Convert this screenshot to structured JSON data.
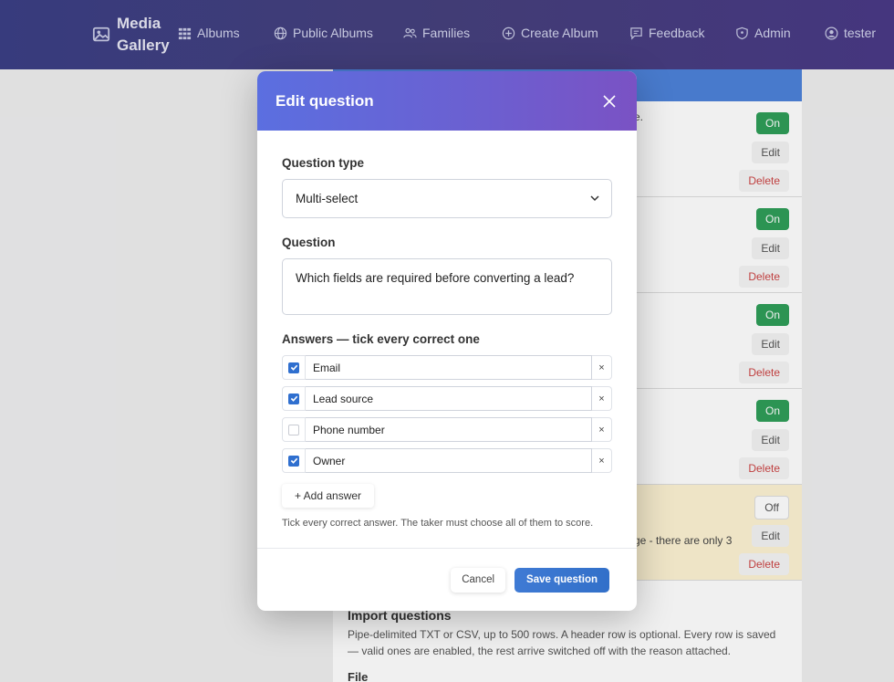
{
  "navbar": {
    "brand_line1": "Media",
    "brand_line2": "Gallery",
    "links": [
      {
        "label": "Albums",
        "icon": "grid-icon"
      },
      {
        "label": "Public Albums",
        "icon": "globe-icon"
      },
      {
        "label": "Families",
        "icon": "people-icon"
      },
      {
        "label": "Create Album",
        "icon": "plus-circle-icon"
      },
      {
        "label": "Feedback",
        "icon": "chat-icon"
      },
      {
        "label": "Admin",
        "icon": "shield-icon"
      },
      {
        "label": "tester",
        "icon": "user-circle-icon"
      }
    ]
  },
  "background": {
    "rows": [
      {
        "toggle": "On",
        "edit": "Edit",
        "delete": "Delete",
        "note": "e."
      },
      {
        "toggle": "On",
        "edit": "Edit",
        "delete": "Delete"
      },
      {
        "toggle": "On",
        "edit": "Edit",
        "delete": "Delete"
      },
      {
        "toggle": "On",
        "edit": "Edit",
        "delete": "Delete"
      },
      {
        "toggle": "Off",
        "edit": "Edit",
        "delete": "Delete",
        "warning": "ge - there are only 3"
      }
    ],
    "import_title": "Import questions",
    "import_desc": "Pipe-delimited TXT or CSV, up to 500 rows. A header row is optional. Every row is saved — valid ones are enabled, the rest arrive switched off with the reason attached.",
    "file_label": "File"
  },
  "modal": {
    "title": "Edit question",
    "question_type_label": "Question type",
    "question_type_value": "Multi-select",
    "question_label": "Question",
    "question_value": "Which fields are required before converting a lead?",
    "answers_label": "Answers — tick every correct one",
    "answers": [
      {
        "text": "Email",
        "checked": true
      },
      {
        "text": "Lead source",
        "checked": true
      },
      {
        "text": "Phone number",
        "checked": false
      },
      {
        "text": "Owner",
        "checked": true
      }
    ],
    "remove_symbol": "×",
    "add_answer_label": "+ Add answer",
    "hint": "Tick every correct answer. The taker must choose all of them to score.",
    "cancel_label": "Cancel",
    "save_label": "Save question"
  },
  "colors": {
    "accent": "#2f6fcf",
    "header_gradient_start": "#5b6fe0",
    "header_gradient_end": "#7a52c4",
    "toggle_on": "#2f9e59"
  }
}
